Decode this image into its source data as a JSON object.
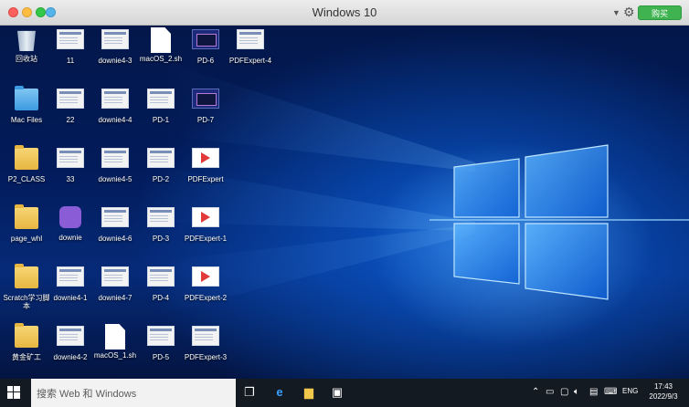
{
  "window": {
    "title": "Windows 10",
    "buy_label": "购买"
  },
  "desktop": {
    "icons": [
      {
        "label": "回收站",
        "kind": "recycle-bin"
      },
      {
        "label": "11",
        "kind": "image"
      },
      {
        "label": "downie4-3",
        "kind": "image"
      },
      {
        "label": "macOS_2.sh",
        "kind": "file"
      },
      {
        "label": "PD-6",
        "kind": "image-dark"
      },
      {
        "label": "PDFExpert-4",
        "kind": "image"
      },
      {
        "label": "Mac Files",
        "kind": "folder-blue"
      },
      {
        "label": "22",
        "kind": "image"
      },
      {
        "label": "downie4-4",
        "kind": "image"
      },
      {
        "label": "PD-1",
        "kind": "image"
      },
      {
        "label": "PD-7",
        "kind": "image-dark"
      },
      {
        "label": "P2_CLASS",
        "kind": "folder"
      },
      {
        "label": "33",
        "kind": "image"
      },
      {
        "label": "downie4-5",
        "kind": "image"
      },
      {
        "label": "PD-2",
        "kind": "image"
      },
      {
        "label": "PDFExpert",
        "kind": "image-pdf"
      },
      {
        "label": "page_whl",
        "kind": "folder"
      },
      {
        "label": "downie",
        "kind": "app-purple"
      },
      {
        "label": "downie4-6",
        "kind": "image"
      },
      {
        "label": "PD-3",
        "kind": "image"
      },
      {
        "label": "PDFExpert-1",
        "kind": "image-pdf"
      },
      {
        "label": "Scratch学习脚本",
        "kind": "folder"
      },
      {
        "label": "downie4-1",
        "kind": "image"
      },
      {
        "label": "downie4-7",
        "kind": "image"
      },
      {
        "label": "PD-4",
        "kind": "image"
      },
      {
        "label": "PDFExpert-2",
        "kind": "image-pdf"
      },
      {
        "label": "黄金矿工",
        "kind": "folder"
      },
      {
        "label": "downie4-2",
        "kind": "image"
      },
      {
        "label": "macOS_1.sh",
        "kind": "file"
      },
      {
        "label": "PD-5",
        "kind": "image"
      },
      {
        "label": "PDFExpert-3",
        "kind": "image"
      }
    ]
  },
  "taskbar": {
    "search_placeholder": "搜索 Web 和 Windows",
    "language": "ENG",
    "time": "17:43",
    "date": "2022/9/3"
  }
}
